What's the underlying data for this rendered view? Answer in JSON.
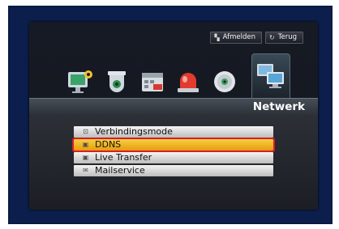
{
  "header": {
    "logout_label": "Afmelden",
    "back_label": "Terug"
  },
  "icons": [
    "monitor-settings-icon",
    "camera-icon",
    "schedule-icon",
    "alarm-icon",
    "disc-icon",
    "network-icon"
  ],
  "selected_icon": "network-icon",
  "tab": {
    "title": "Netwerk"
  },
  "menu": {
    "items": [
      {
        "label": "Verbindingsmode",
        "icon": "connection-icon"
      },
      {
        "label": "DDNS",
        "icon": "ddns-icon"
      },
      {
        "label": "Live Transfer",
        "icon": "transfer-icon"
      },
      {
        "label": "Mailservice",
        "icon": "mail-icon"
      }
    ],
    "selected_label": "DDNS"
  },
  "colors": {
    "highlight": "#f0b52a",
    "selection_outline": "#d81d28",
    "frame": "#0c1f4c"
  }
}
